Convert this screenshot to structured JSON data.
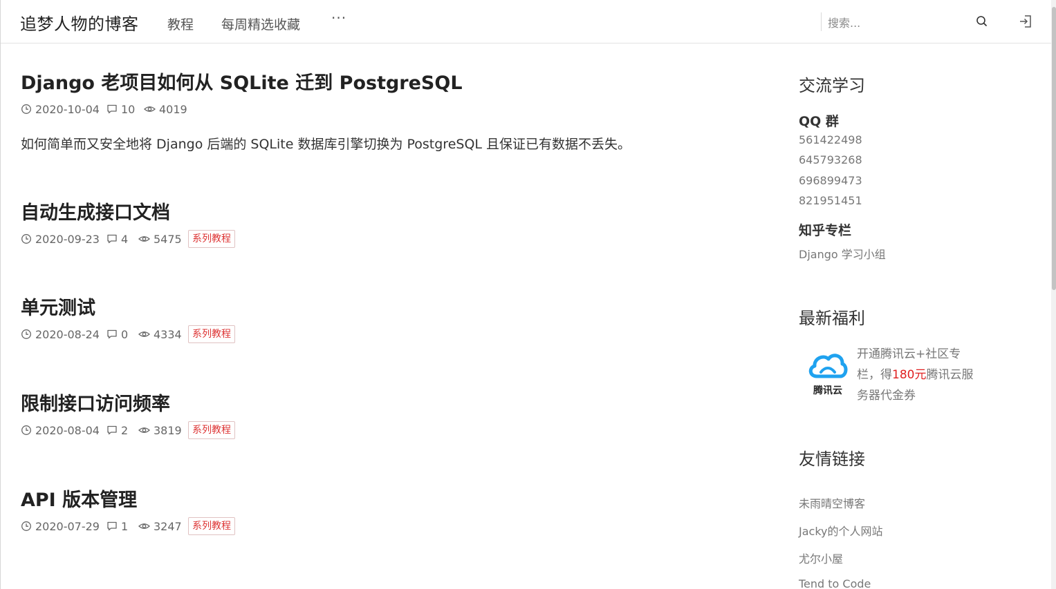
{
  "header": {
    "brand": "追梦人物的博客",
    "nav": [
      "教程",
      "每周精选收藏"
    ],
    "more": "···",
    "search_placeholder": "搜索..."
  },
  "posts": [
    {
      "title": "Django 老项目如何从 SQLite 迁到 PostgreSQL",
      "date": "2020-10-04",
      "comments": "10",
      "views": "4019",
      "excerpt": "如何简单而又安全地将 Django 后端的 SQLite 数据库引擎切换为 PostgreSQL 且保证已有数据不丢失。"
    },
    {
      "title": "自动生成接口文档",
      "date": "2020-09-23",
      "comments": "4",
      "views": "5475",
      "tag": "系列教程"
    },
    {
      "title": "单元测试",
      "date": "2020-08-24",
      "comments": "0",
      "views": "4334",
      "tag": "系列教程"
    },
    {
      "title": "限制接口访问频率",
      "date": "2020-08-04",
      "comments": "2",
      "views": "3819",
      "tag": "系列教程"
    },
    {
      "title": "API 版本管理",
      "date": "2020-07-29",
      "comments": "1",
      "views": "3247",
      "tag": "系列教程"
    }
  ],
  "sidebar": {
    "study": {
      "heading": "交流学习",
      "qq_label": "QQ 群",
      "qq_groups": [
        "561422498",
        "645793268",
        "696899473",
        "821951451"
      ],
      "zhihu_label": "知乎专栏",
      "zhihu_link": "Django 学习小组"
    },
    "promo": {
      "heading": "最新福利",
      "logo_text": "腾讯云",
      "text_before": "开通腾讯云+社区专栏，得",
      "highlight": "180元",
      "text_after": "腾讯云服务器代金券"
    },
    "links": {
      "heading": "友情链接",
      "items": [
        "未雨晴空博客",
        "Jacky的个人网站",
        "尤尔小屋",
        "Tend to Code"
      ]
    }
  },
  "colors": {
    "accent_red": "#e02020",
    "tag_border": "#e0c2c2",
    "cloud_blue": "#1fa2ef"
  }
}
